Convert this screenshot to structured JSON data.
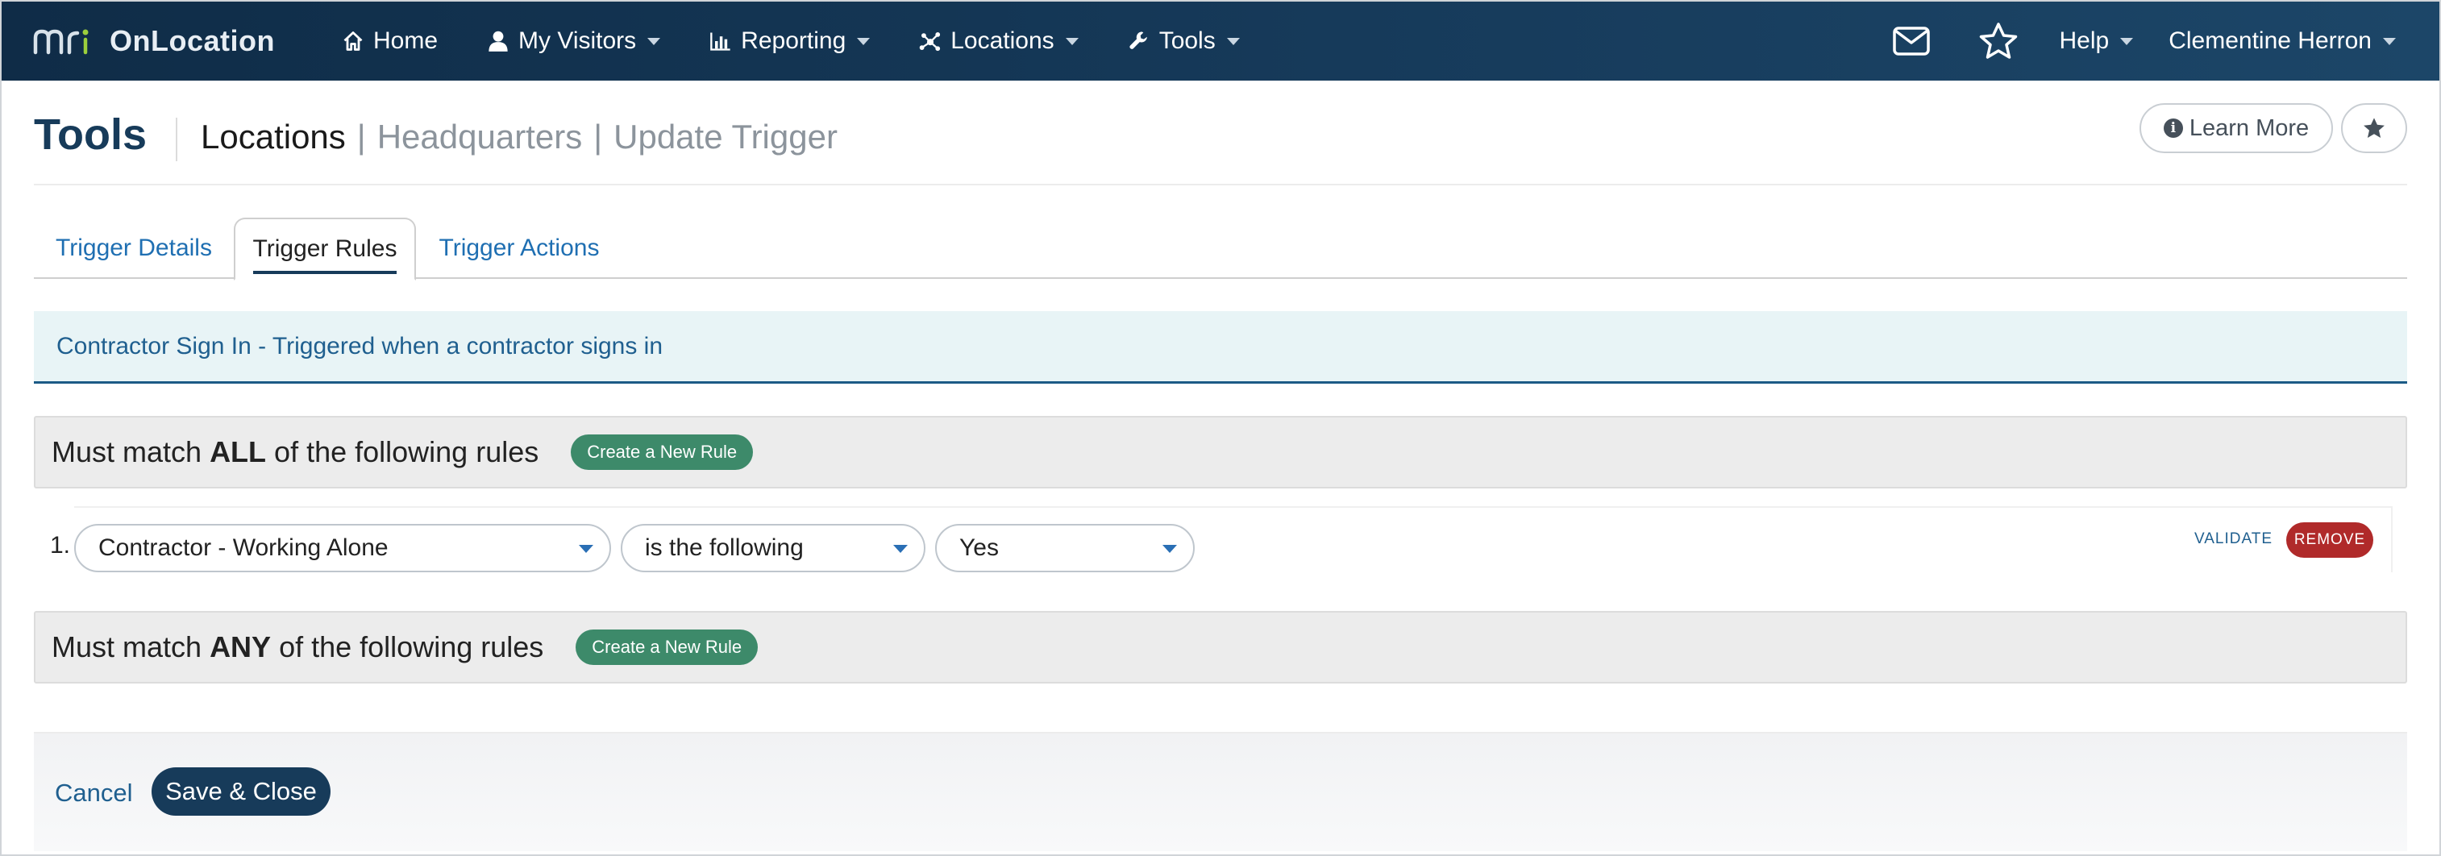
{
  "app": {
    "brand_name": "OnLocation",
    "logo_text": "mri"
  },
  "nav": {
    "items": [
      {
        "label": "Home",
        "icon": "home-icon",
        "has_dropdown": false
      },
      {
        "label": "My Visitors",
        "icon": "user-icon",
        "has_dropdown": true
      },
      {
        "label": "Reporting",
        "icon": "bar-chart-icon",
        "has_dropdown": true
      },
      {
        "label": "Locations",
        "icon": "network-icon",
        "has_dropdown": true
      },
      {
        "label": "Tools",
        "icon": "wrench-icon",
        "has_dropdown": true
      }
    ],
    "right": {
      "mail_icon": "envelope-icon",
      "favorites_icon": "star-icon",
      "help_label": "Help",
      "user_name": "Clementine Herron"
    }
  },
  "header": {
    "title": "Tools",
    "breadcrumb": {
      "section": "Locations",
      "location": "Headquarters",
      "page": "Update Trigger",
      "separator": "|"
    },
    "learn_more_label": "Learn More",
    "info_glyph": "i",
    "favorite_icon": "star-icon"
  },
  "tabs": [
    {
      "label": "Trigger Details",
      "active": false
    },
    {
      "label": "Trigger Rules",
      "active": true
    },
    {
      "label": "Trigger Actions",
      "active": false
    }
  ],
  "trigger_description": "Contractor Sign In - Triggered when a contractor signs in",
  "rule_groups": {
    "all": {
      "prefix": "Must match ",
      "keyword": "ALL",
      "suffix": " of the following rules",
      "button_label": "Create a New Rule"
    },
    "any": {
      "prefix": "Must match ",
      "keyword": "ANY",
      "suffix": " of the following rules",
      "button_label": "Create a New Rule"
    }
  },
  "rules": [
    {
      "number": "1.",
      "field": "Contractor - Working Alone",
      "operator": "is the following",
      "value": "Yes",
      "validate_label": "VALIDATE",
      "remove_label": "REMOVE"
    }
  ],
  "footer": {
    "cancel_label": "Cancel",
    "save_label": "Save & Close"
  },
  "colors": {
    "nav_bg": "#163a5a",
    "accent_link": "#1f6fb2",
    "primary_button": "#173b5a",
    "create_rule_button": "#3d8a6a",
    "remove_button": "#b02a2a",
    "description_bg": "#e8f4f6"
  }
}
